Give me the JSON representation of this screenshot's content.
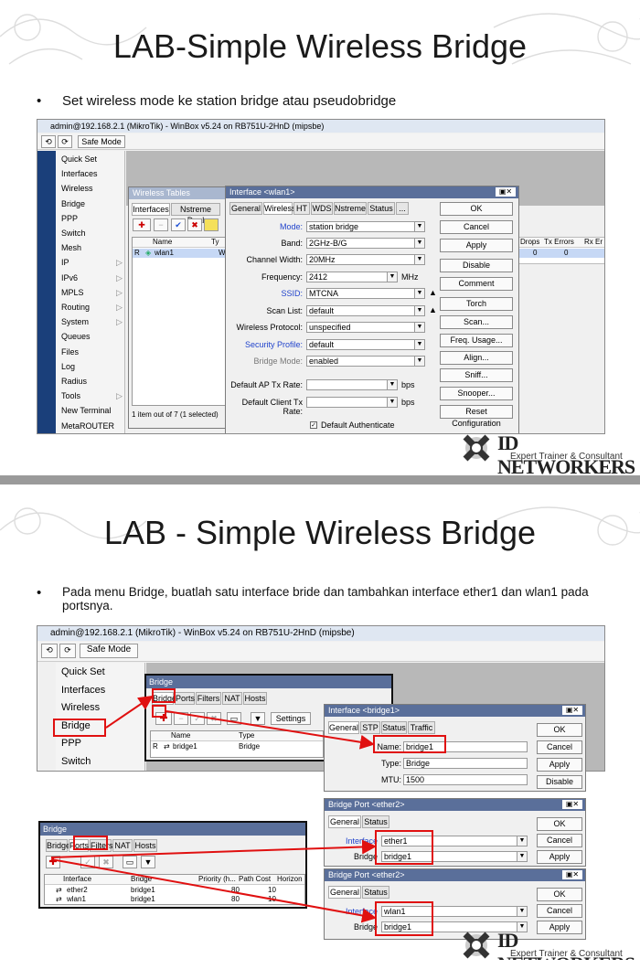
{
  "slide1": {
    "title": "LAB-Simple Wireless Bridge",
    "bullet": "Set wireless mode ke station bridge atau pseudobridge",
    "winbox_title": "admin@192.168.2.1 (MikroTik) - WinBox v5.24 on RB751U-2HnD (mipsbe)",
    "safe_mode": "Safe Mode",
    "sidebar": [
      "Quick Set",
      "Interfaces",
      "Wireless",
      "Bridge",
      "PPP",
      "Switch",
      "Mesh",
      "IP",
      "IPv6",
      "MPLS",
      "Routing",
      "System",
      "Queues",
      "Files",
      "Log",
      "Radius",
      "Tools",
      "New Terminal",
      "MetaROUTER"
    ],
    "wireless_tables": {
      "title": "Wireless Tables",
      "tabs": [
        "Interfaces",
        "Nstreme Dual"
      ],
      "col_name": "Name",
      "col_type": "Ty",
      "row_flag": "R",
      "row_name": "wlan1",
      "row_type": "W",
      "status": "1 item out of 7 (1 selected)",
      "extra_cols": [
        "Drops",
        "Tx Errors",
        "Rx Er"
      ],
      "extra_vals": [
        "0",
        "0"
      ]
    },
    "iface_dialog": {
      "title": "Interface <wlan1>",
      "tabs": [
        "General",
        "Wireless",
        "HT",
        "WDS",
        "Nstreme",
        "Status",
        "..."
      ],
      "fields": [
        {
          "label": "Mode:",
          "value": "station bridge",
          "color": "blue"
        },
        {
          "label": "Band:",
          "value": "2GHz-B/G",
          "color": "black"
        },
        {
          "label": "Channel Width:",
          "value": "20MHz",
          "color": "black"
        },
        {
          "label": "Frequency:",
          "value": "2412",
          "color": "black",
          "unit": "MHz"
        },
        {
          "label": "SSID:",
          "value": "MTCNA",
          "color": "blue"
        },
        {
          "label": "Scan List:",
          "value": "default",
          "color": "black"
        },
        {
          "label": "Wireless Protocol:",
          "value": "unspecified",
          "color": "black"
        },
        {
          "label": "Security Profile:",
          "value": "default",
          "color": "blue"
        },
        {
          "label": "Bridge Mode:",
          "value": "enabled",
          "color": "grey"
        },
        {
          "label": "Default AP Tx Rate:",
          "value": "",
          "color": "black",
          "unit": "bps"
        },
        {
          "label": "Default Client Tx Rate:",
          "value": "",
          "color": "black",
          "unit": "bps"
        }
      ],
      "checkbox": "Default Authenticate",
      "buttons": [
        "OK",
        "Cancel",
        "Apply",
        "Disable",
        "Comment",
        "Torch",
        "Scan...",
        "Freq. Usage...",
        "Align...",
        "Sniff...",
        "Snooper...",
        "Reset Configuration"
      ]
    }
  },
  "slide2": {
    "title": "LAB - Simple Wireless Bridge",
    "bullet": "Pada menu Bridge, buatlah satu interface bride dan tambahkan interface ether1 dan wlan1 pada portsnya.",
    "winbox_title": "admin@192.168.2.1 (MikroTik) - WinBox v5.24 on RB751U-2HnD (mipsbe)",
    "safe_mode": "Safe Mode",
    "sidebar": [
      "Quick Set",
      "Interfaces",
      "Wireless",
      "Bridge",
      "PPP",
      "Switch"
    ],
    "bridge_win": {
      "title": "Bridge",
      "tabs": [
        "Bridge",
        "Ports",
        "Filters",
        "NAT",
        "Hosts"
      ],
      "settings": "Settings",
      "cols": [
        "Name",
        "Type"
      ],
      "row": [
        "bridge1",
        "Bridge"
      ],
      "flag": "R"
    },
    "iface_bridge_dlg": {
      "title": "Interface <bridge1>",
      "tabs": [
        "General",
        "STP",
        "Status",
        "Traffic"
      ],
      "fields": [
        {
          "label": "Name:",
          "value": "bridge1"
        },
        {
          "label": "Type:",
          "value": "Bridge"
        },
        {
          "label": "MTU:",
          "value": "1500"
        }
      ],
      "buttons": [
        "OK",
        "Cancel",
        "Apply",
        "Disable"
      ]
    },
    "ports_win": {
      "title": "Bridge",
      "tabs": [
        "Bridge",
        "Ports",
        "Filters",
        "NAT",
        "Hosts"
      ],
      "cols": [
        "Interface",
        "Bridge",
        "Priority (h...",
        "Path Cost",
        "Horizon"
      ],
      "rows": [
        [
          "ether2",
          "bridge1",
          "80",
          "10"
        ],
        [
          "wlan1",
          "bridge1",
          "80",
          "10"
        ]
      ]
    },
    "port_dlg1": {
      "title": "Bridge Port <ether2>",
      "tabs": [
        "General",
        "Status"
      ],
      "iface_label": "Interface",
      "iface_value": "ether1",
      "bridge_label": "Bridge",
      "bridge_value": "bridge1",
      "buttons": [
        "OK",
        "Cancel",
        "Apply"
      ]
    },
    "port_dlg2": {
      "title": "Bridge Port <ether2>",
      "tabs": [
        "General",
        "Status"
      ],
      "iface_label": "Interface",
      "iface_value": "wlan1",
      "bridge_label": "Bridge",
      "bridge_value": "bridge1",
      "buttons": [
        "OK",
        "Cancel",
        "Apply"
      ]
    }
  },
  "logo": {
    "brand_id": "ID",
    "brand_net": "NETWORKERS",
    "tagline": "Expert Trainer & Consultant"
  },
  "colors": {
    "accent": "#e01010",
    "dialog_header": "#5a6f9a",
    "field_blue": "#2244cc"
  }
}
